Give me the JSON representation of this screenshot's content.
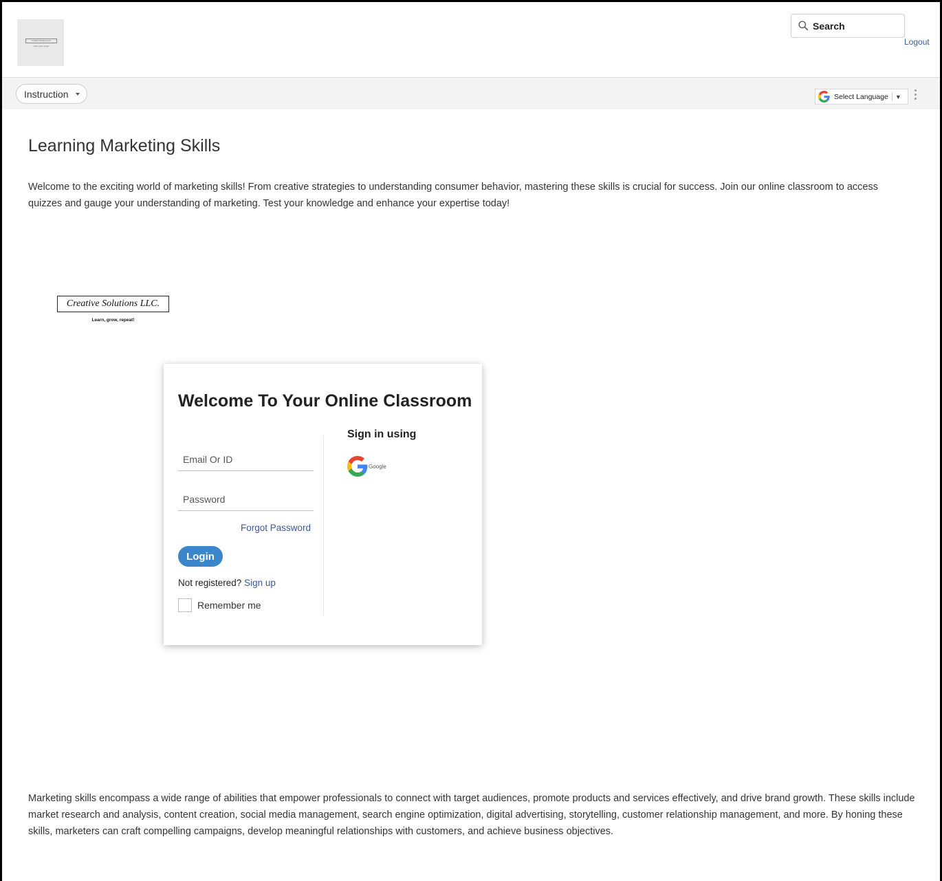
{
  "header": {
    "logo_small_name": "Creative Solutions LLC.",
    "logo_small_tag": "Learn, grow, repeat!",
    "search_label": "Search",
    "logout_label": "Logout"
  },
  "navbar": {
    "instruction_label": "Instruction",
    "language_label": "Select Language",
    "language_arrow": "▼"
  },
  "main": {
    "title": "Learning Marketing Skills",
    "intro": "Welcome to the exciting world of marketing skills! From creative strategies to understanding consumer behavior, mastering these skills is crucial for success. Join our online classroom to access quizzes and gauge your understanding of marketing. Test your knowledge and enhance your expertise today!",
    "brand_name": "Creative Solutions LLC.",
    "brand_tagline": "Learn, grow, repeat!",
    "bottom": "Marketing skills encompass a wide range of abilities that empower professionals to connect with target audiences, promote products and services effectively, and drive brand growth. These skills include market research and analysis, content creation, social media management, search engine optimization, digital advertising, storytelling, customer relationship management, and more. By honing these skills, marketers can craft compelling campaigns, develop meaningful relationships with customers, and achieve business objectives."
  },
  "login": {
    "title": "Welcome To Your Online Classroom",
    "email_placeholder": "Email Or ID",
    "email_value": "",
    "password_placeholder": "Password",
    "password_value": "",
    "forgot_label": "Forgot Password",
    "login_label": "Login",
    "not_registered": "Not registered?",
    "signup_label": "Sign up",
    "remember_label": "Remember me",
    "remember_checked": false,
    "signin_heading": "Sign in using",
    "google_label": "Google"
  },
  "icons": {
    "search": "search-icon",
    "google": "google-icon",
    "caret": "chevron-down-icon",
    "kebab": "more-vertical-icon"
  },
  "colors": {
    "link": "#3b5998",
    "login_button": "#3a86c8",
    "navbar_bg": "#f3f3f3"
  }
}
